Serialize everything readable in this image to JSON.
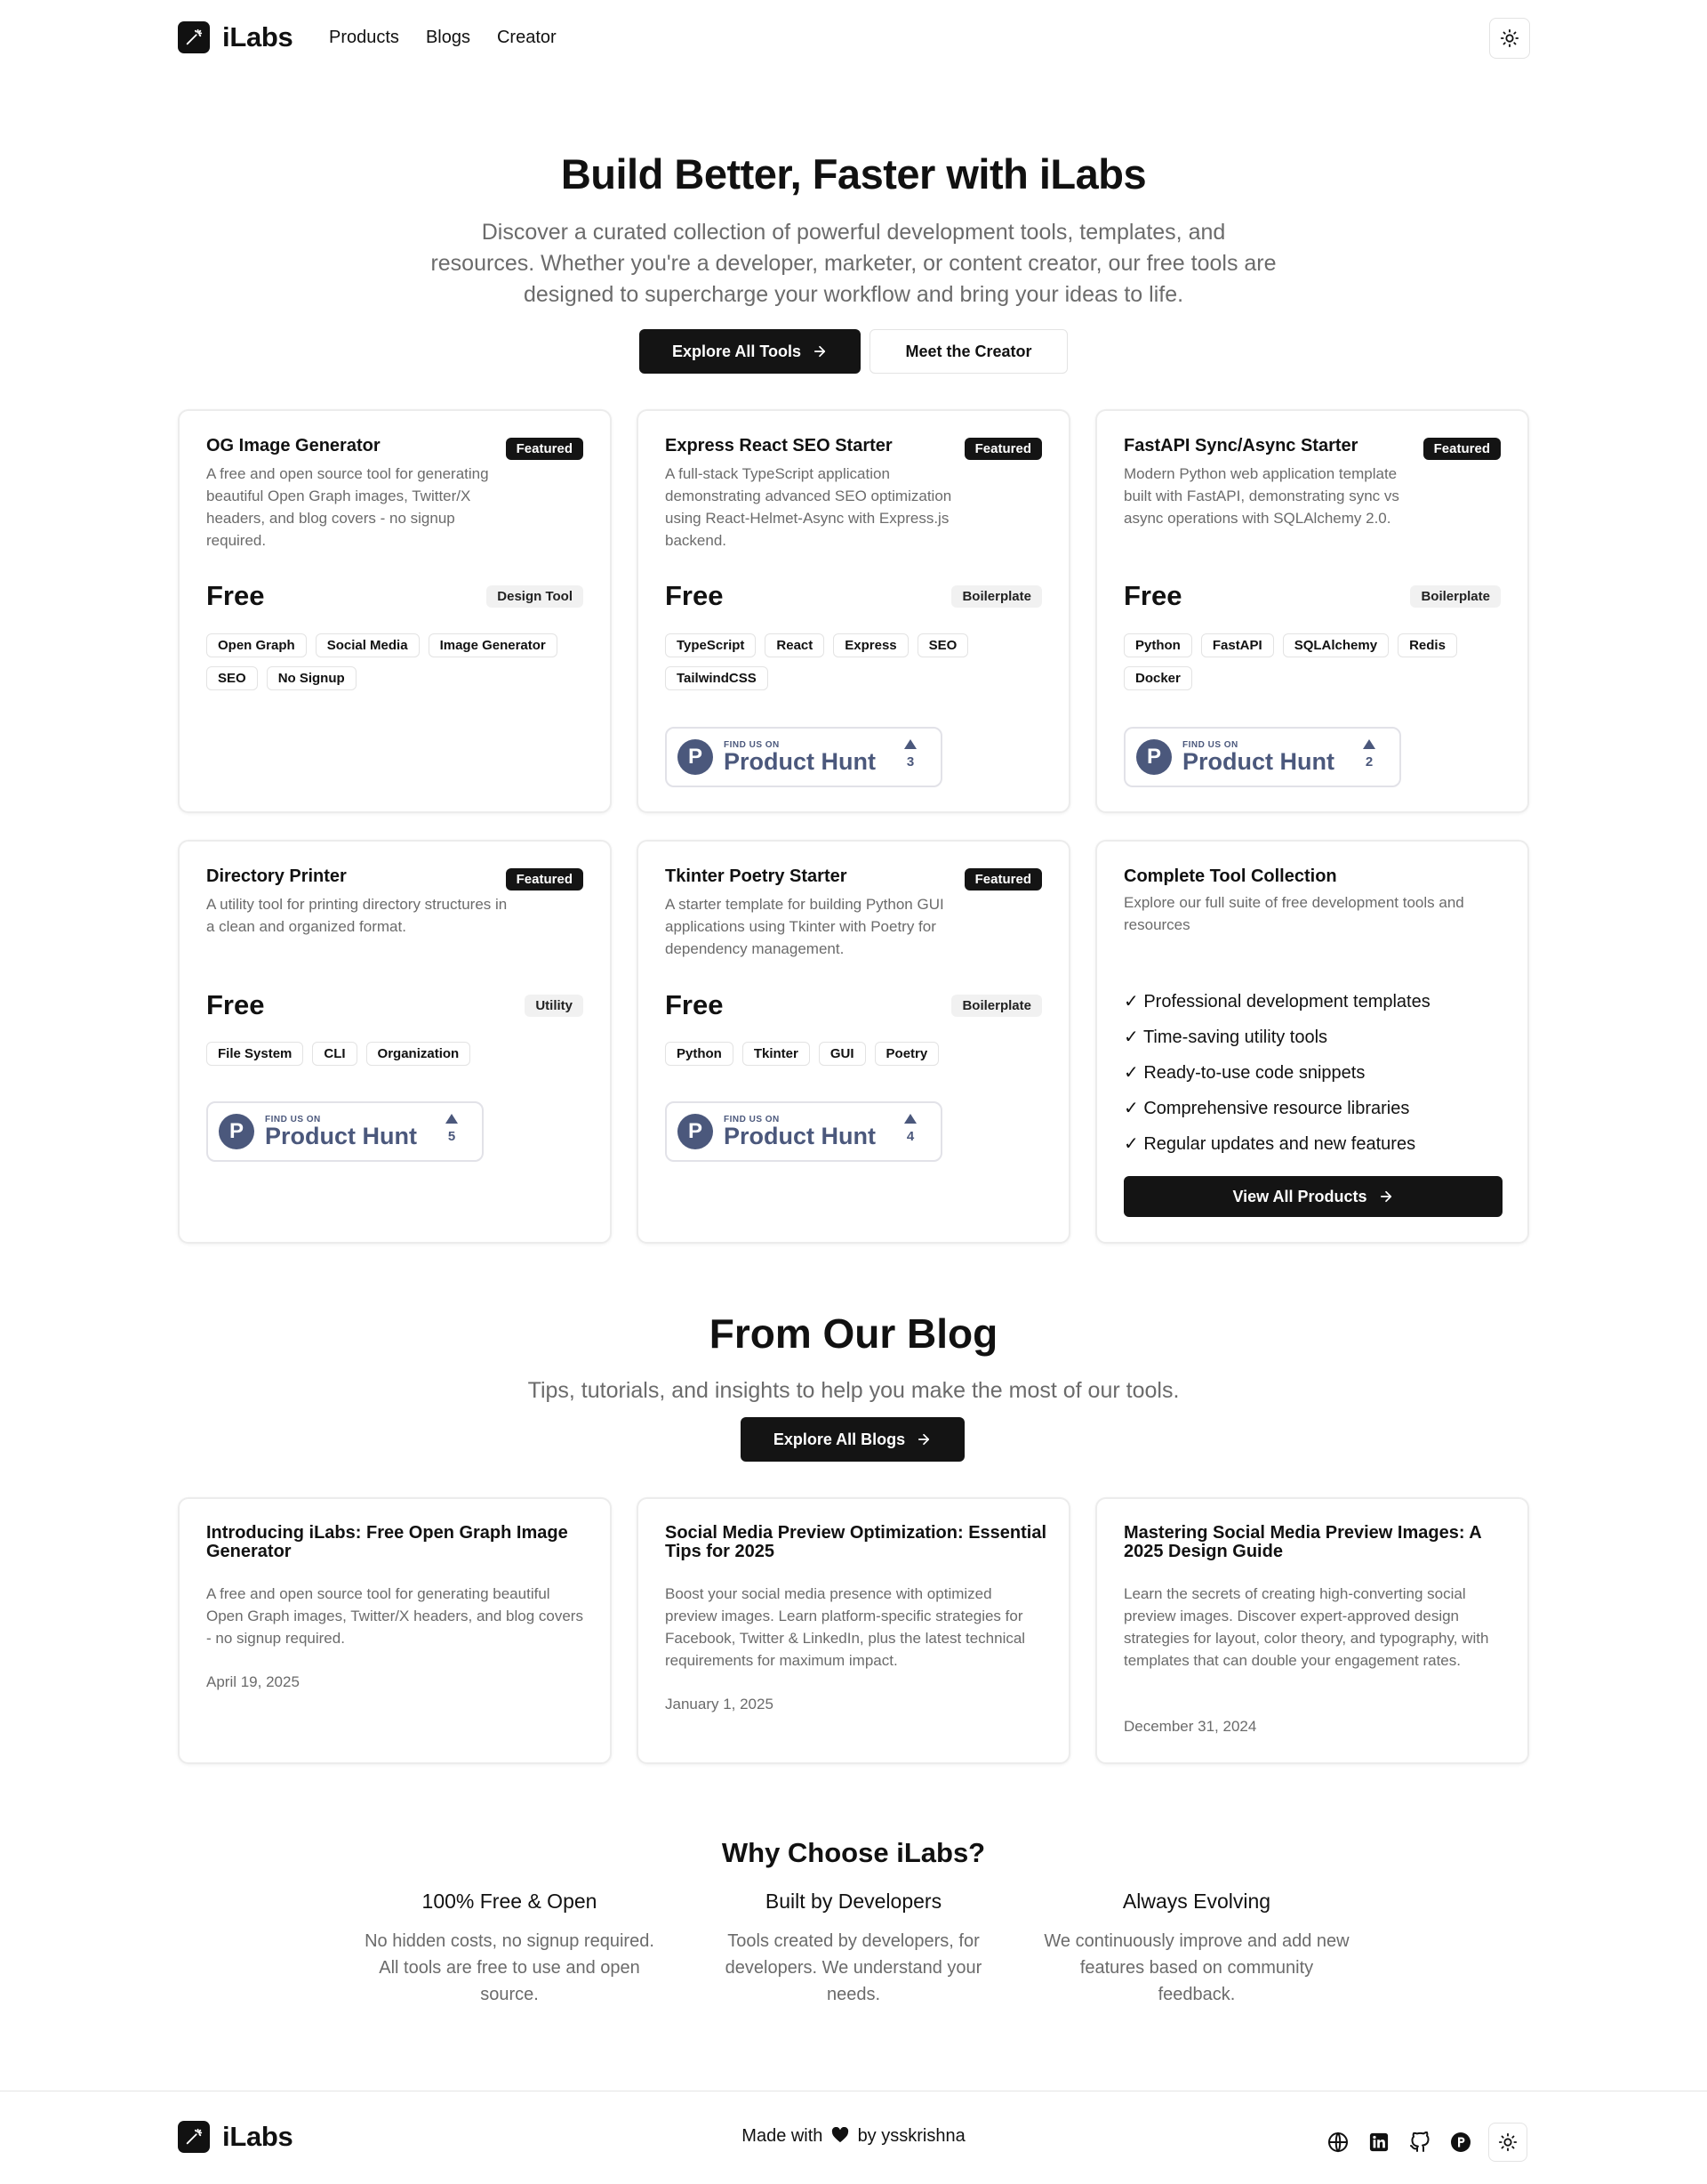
{
  "header": {
    "brand": "iLabs",
    "nav": [
      "Products",
      "Blogs",
      "Creator"
    ]
  },
  "hero": {
    "title": "Build Better, Faster with iLabs",
    "description": "Discover a curated collection of powerful development tools, templates, and resources. Whether you're a developer, marketer, or content creator, our free tools are designed to supercharge your workflow and bring your ideas to life.",
    "primary_button": "Explore All Tools",
    "secondary_button": "Meet the Creator"
  },
  "products": [
    {
      "title": "OG Image Generator",
      "badge": "Featured",
      "description": "A free and open source tool for generating beautiful Open Graph images, Twitter/X headers, and blog covers - no signup required.",
      "price": "Free",
      "category": "Design Tool",
      "tags": [
        "Open Graph",
        "Social Media",
        "Image Generator",
        "SEO",
        "No Signup"
      ]
    },
    {
      "title": "Express React SEO Starter",
      "badge": "Featured",
      "description": "A full-stack TypeScript application demonstrating advanced SEO optimization using React-Helmet-Async with Express.js backend.",
      "price": "Free",
      "category": "Boilerplate",
      "tags": [
        "TypeScript",
        "React",
        "Express",
        "SEO",
        "TailwindCSS"
      ],
      "ph_small": "FIND US ON",
      "ph_big": "Product Hunt",
      "ph_votes": "3"
    },
    {
      "title": "FastAPI Sync/Async Starter",
      "badge": "Featured",
      "description": "Modern Python web application template built with FastAPI, demonstrating sync vs async operations with SQLAlchemy 2.0.",
      "price": "Free",
      "category": "Boilerplate",
      "tags": [
        "Python",
        "FastAPI",
        "SQLAlchemy",
        "Redis",
        "Docker"
      ],
      "ph_small": "FIND US ON",
      "ph_big": "Product Hunt",
      "ph_votes": "2"
    },
    {
      "title": "Directory Printer",
      "badge": "Featured",
      "description": "A utility tool for printing directory structures in a clean and organized format.",
      "price": "Free",
      "category": "Utility",
      "tags": [
        "File System",
        "CLI",
        "Organization"
      ],
      "ph_small": "FIND US ON",
      "ph_big": "Product Hunt",
      "ph_votes": "5"
    },
    {
      "title": "Tkinter Poetry Starter",
      "badge": "Featured",
      "description": "A starter template for building Python GUI applications using Tkinter with Poetry for dependency management.",
      "price": "Free",
      "category": "Boilerplate",
      "tags": [
        "Python",
        "Tkinter",
        "GUI",
        "Poetry"
      ],
      "ph_small": "FIND US ON",
      "ph_big": "Product Hunt",
      "ph_votes": "4"
    }
  ],
  "collection": {
    "title": "Complete Tool Collection",
    "description": "Explore our full suite of free development tools and resources",
    "items": [
      "✓ Professional development templates",
      "✓ Time-saving utility tools",
      "✓ Ready-to-use code snippets",
      "✓ Comprehensive resource libraries",
      "✓ Regular updates and new features"
    ],
    "button": "View All Products"
  },
  "blog": {
    "title": "From Our Blog",
    "subtitle": "Tips, tutorials, and insights to help you make the most of our tools.",
    "button": "Explore All Blogs",
    "posts": [
      {
        "title": "Introducing iLabs: Free Open Graph Image Generator",
        "description": "A free and open source tool for generating beautiful Open Graph images, Twitter/X headers, and blog covers - no signup required.",
        "date": "April 19, 2025"
      },
      {
        "title": "Social Media Preview Optimization: Essential Tips for 2025",
        "description": "Boost your social media presence with optimized preview images. Learn platform-specific strategies for Facebook, Twitter & LinkedIn, plus the latest technical requirements for maximum impact.",
        "date": "January 1, 2025"
      },
      {
        "title": "Mastering Social Media Preview Images: A 2025 Design Guide",
        "description": "Learn the secrets of creating high-converting social preview images. Discover expert-approved design strategies for layout, color theory, and typography, with templates that can double your engagement rates.",
        "date": "December 31, 2024"
      }
    ]
  },
  "why": {
    "title": "Why Choose iLabs?",
    "items": [
      {
        "title": "100% Free & Open",
        "text": "No hidden costs, no signup required. All tools are free to use and open source."
      },
      {
        "title": "Built by Developers",
        "text": "Tools created by developers, for developers. We understand your needs."
      },
      {
        "title": "Always Evolving",
        "text": "We continuously improve and add new features based on community feedback."
      }
    ]
  },
  "footer": {
    "brand": "iLabs",
    "made_with": "Made with",
    "by": "by ysskrishna"
  },
  "icons": {
    "logo": "magic-wand-icon",
    "theme": "sun-icon",
    "arrow": "arrow-right-icon",
    "heart": "heart-icon",
    "globe": "globe-icon",
    "linkedin": "linkedin-icon",
    "github": "github-icon",
    "producthunt": "product-hunt-icon"
  },
  "colors": {
    "primary": "#141414",
    "muted_text": "#6b6b6b",
    "product_hunt": "#4b587c",
    "border": "#ececec"
  }
}
